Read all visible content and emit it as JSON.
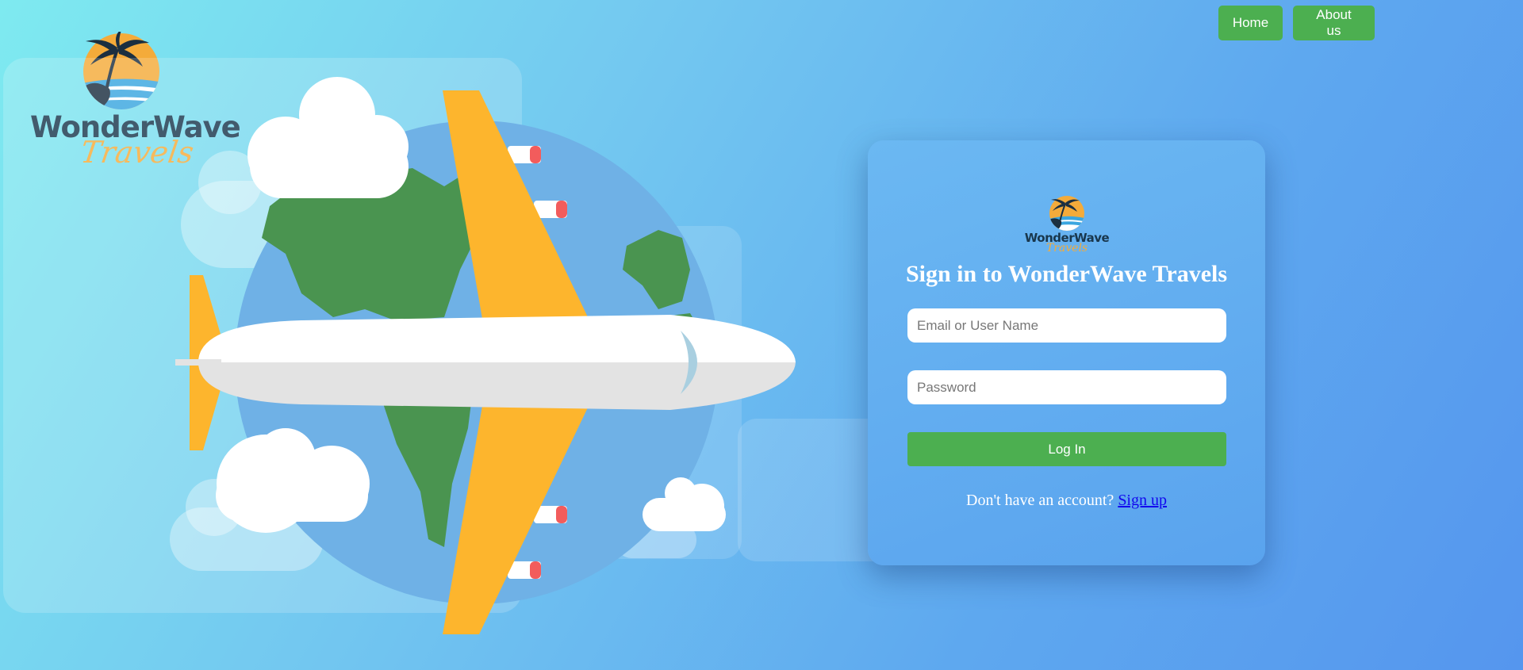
{
  "nav": {
    "home_label": "Home",
    "about_label": "About us"
  },
  "logo": {
    "brand": "WonderWave",
    "tagline": "Travels"
  },
  "login": {
    "title": "Sign in to WonderWave Travels",
    "email_placeholder": "Email or User Name",
    "email_value": "",
    "password_placeholder": "Password",
    "password_value": "",
    "login_label": "Log In",
    "signup_prompt": "Don't have an account?",
    "signup_link": "Sign up"
  },
  "colors": {
    "accent_green": "#4caf50",
    "brand_navy": "#19374d",
    "brand_orange": "#f4ab3a",
    "link_blue": "#1208ee"
  }
}
